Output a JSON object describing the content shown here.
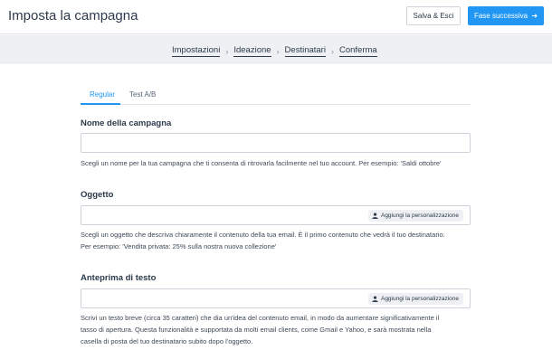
{
  "header": {
    "title": "Imposta la campagna",
    "save_label": "Salva & Esci",
    "next_label": "Fase successiva"
  },
  "steps": [
    "Impostazioni",
    "Ideazione",
    "Destinatari",
    "Conferma"
  ],
  "tabs": [
    "Regular",
    "Test A/B"
  ],
  "colors": {
    "accent": "#2196f3",
    "text": "#2c3a4b"
  },
  "form": {
    "campaign_name": {
      "label": "Nome della campagna",
      "value": "",
      "help": "Scegli un nome per la tua campagna che ti consenta di ritrovarla facilmente nel tuo account. Per esempio: 'Saldi ottobre'"
    },
    "subject": {
      "label": "Oggetto",
      "value": "",
      "personalize_label": "Aggiungi la personalizzazione",
      "help_line1": "Scegli un oggetto che descriva chiaramente il contenuto della tua email. È il primo contenuto che vedrà il tuo destinatario.",
      "help_line2": "Per esempio: 'Vendita privata: 25% sulla nostra nuova collezione'"
    },
    "preview_text": {
      "label": "Anteprima di testo",
      "value": "",
      "personalize_label": "Aggiungi la personalizzazione",
      "help_line1": "Scrivi un testo breve (circa 35 caratteri) che dia un'idea del contenuto email, in modo da aumentare significativamente il",
      "help_line2": "tasso di apertura. Questa funzionalità e supportata da molti email clients, come Gmail e Yahoo, e sarà mostrata nella",
      "help_line3": "casella di posta del tuo destinatario subito dopo l'oggetto."
    }
  }
}
